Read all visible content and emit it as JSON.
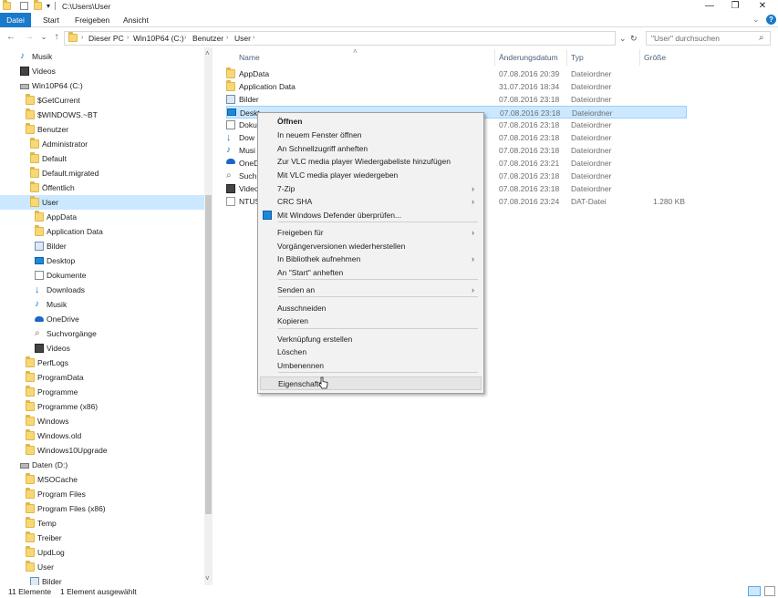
{
  "window": {
    "path": "C:\\Users\\User",
    "min_icon": "minimize-icon",
    "max_icon": "restore-icon",
    "close_icon": "close-icon",
    "min_glyph": "—",
    "max_glyph": "❐",
    "close_glyph": "✕"
  },
  "ribbon": {
    "tabs": [
      "Datei",
      "Start",
      "Freigeben",
      "Ansicht"
    ],
    "accent": "#1979ca",
    "help_glyph": "?",
    "expand_glyph": "⌄"
  },
  "address": {
    "back": "←",
    "forward": "→",
    "recent": "⌄",
    "up": "↑",
    "crumbs": [
      "Dieser PC",
      "Win10P64 (C:)",
      "Benutzer",
      "User"
    ],
    "sep": "›",
    "dropdown": "⌄",
    "refresh": "↻"
  },
  "search": {
    "placeholder": "\"User\" durchsuchen",
    "icon": "⌕"
  },
  "nav": {
    "items": [
      {
        "label": "Musik",
        "icon": "music-icon"
      },
      {
        "label": "Videos",
        "icon": "videos-icon"
      },
      {
        "label": "Win10P64 (C:)",
        "icon": "drive-icon"
      },
      {
        "label": "$GetCurrent",
        "icon": "folder-icon"
      },
      {
        "label": "$WINDOWS.~BT",
        "icon": "folder-icon"
      },
      {
        "label": "Benutzer",
        "icon": "folder-icon"
      },
      {
        "label": "Administrator",
        "icon": "folder-icon"
      },
      {
        "label": "Default",
        "icon": "folder-icon"
      },
      {
        "label": "Default.migrated",
        "icon": "folder-icon"
      },
      {
        "label": "Öffentlich",
        "icon": "folder-icon"
      },
      {
        "label": "User",
        "icon": "folder-icon"
      },
      {
        "label": "AppData",
        "icon": "folder-icon"
      },
      {
        "label": "Application Data",
        "icon": "folder-icon"
      },
      {
        "label": "Bilder",
        "icon": "pictures-icon"
      },
      {
        "label": "Desktop",
        "icon": "desktop-icon"
      },
      {
        "label": "Dokumente",
        "icon": "documents-icon"
      },
      {
        "label": "Downloads",
        "icon": "downloads-icon"
      },
      {
        "label": "Musik",
        "icon": "music-icon"
      },
      {
        "label": "OneDrive",
        "icon": "onedrive-icon"
      },
      {
        "label": "Suchvorgänge",
        "icon": "search-icon"
      },
      {
        "label": "Videos",
        "icon": "videos-icon"
      },
      {
        "label": "PerfLogs",
        "icon": "folder-icon"
      },
      {
        "label": "ProgramData",
        "icon": "folder-icon"
      },
      {
        "label": "Programme",
        "icon": "folder-icon"
      },
      {
        "label": "Programme (x86)",
        "icon": "folder-icon"
      },
      {
        "label": "Windows",
        "icon": "folder-icon"
      },
      {
        "label": "Windows.old",
        "icon": "folder-icon"
      },
      {
        "label": "Windows10Upgrade",
        "icon": "folder-icon"
      },
      {
        "label": "Daten (D:)",
        "icon": "drive-icon"
      },
      {
        "label": "MSOCache",
        "icon": "folder-icon"
      },
      {
        "label": "Program Files",
        "icon": "folder-icon"
      },
      {
        "label": "Program Files (x86)",
        "icon": "folder-icon"
      },
      {
        "label": "Temp",
        "icon": "folder-icon"
      },
      {
        "label": "Treiber",
        "icon": "folder-icon"
      },
      {
        "label": "UpdLog",
        "icon": "folder-icon"
      },
      {
        "label": "User",
        "icon": "folder-icon"
      },
      {
        "label": "Bilder",
        "icon": "pictures-icon"
      }
    ],
    "scroll_up": "˄",
    "scroll_down": "˅"
  },
  "columns": {
    "name": "Name",
    "date": "Änderungsdatum",
    "type": "Typ",
    "size": "Größe",
    "sort_glyph": "˄"
  },
  "files": [
    {
      "name": "AppData",
      "date": "07.08.2016 20:39",
      "type": "Dateiordner",
      "size": "",
      "icon": "folder-icon"
    },
    {
      "name": "Application Data",
      "date": "31.07.2016 18:34",
      "type": "Dateiordner",
      "size": "",
      "icon": "folder-icon"
    },
    {
      "name": "Bilder",
      "date": "07.08.2016 23:18",
      "type": "Dateiordner",
      "size": "",
      "icon": "pictures-icon"
    },
    {
      "name": "Desktop",
      "date": "07.08.2016 23:18",
      "type": "Dateiordner",
      "size": "",
      "icon": "desktop-icon"
    },
    {
      "name": "Dokumente",
      "date": "07.08.2016 23:18",
      "type": "Dateiordner",
      "size": "",
      "icon": "documents-icon"
    },
    {
      "name": "Downloads",
      "date": "07.08.2016 23:18",
      "type": "Dateiordner",
      "size": "",
      "icon": "downloads-icon"
    },
    {
      "name": "Musik",
      "date": "07.08.2016 23:18",
      "type": "Dateiordner",
      "size": "",
      "icon": "music-icon"
    },
    {
      "name": "OneDrive",
      "date": "07.08.2016 23:21",
      "type": "Dateiordner",
      "size": "",
      "icon": "onedrive-icon"
    },
    {
      "name": "Suchvorgänge",
      "date": "07.08.2016 23:18",
      "type": "Dateiordner",
      "size": "",
      "icon": "search-icon"
    },
    {
      "name": "Videos",
      "date": "07.08.2016 23:18",
      "type": "Dateiordner",
      "size": "",
      "icon": "videos-icon"
    },
    {
      "name": "NTUSER.DAT",
      "date": "07.08.2016 23:24",
      "type": "DAT-Datei",
      "size": "1.280 KB",
      "icon": "file-icon"
    }
  ],
  "file_name_visible": [
    "AppData",
    "Application Data",
    "Bilder",
    "Deskt",
    "Doku",
    "Dow",
    "Musi",
    "OneD",
    "Such",
    "Video",
    "NTUS"
  ],
  "context_menu": {
    "items": [
      {
        "label": "Öffnen",
        "bold": true
      },
      {
        "label": "In neuem Fenster öffnen"
      },
      {
        "label": "An Schnellzugriff anheften"
      },
      {
        "label": "Zur VLC media player Wiedergabeliste hinzufügen"
      },
      {
        "label": "Mit VLC media player wiedergeben"
      },
      {
        "label": "7-Zip",
        "submenu": true
      },
      {
        "label": "CRC SHA",
        "submenu": true
      },
      {
        "label": "Mit Windows Defender überprüfen...",
        "icon": "windows-defender-icon"
      },
      {
        "label": "Freigeben für",
        "submenu": true
      },
      {
        "label": "Vorgängerversionen wiederherstellen"
      },
      {
        "label": "In Bibliothek aufnehmen",
        "submenu": true
      },
      {
        "label": "An \"Start\" anheften"
      },
      {
        "label": "Senden an",
        "submenu": true
      },
      {
        "label": "Ausschneiden"
      },
      {
        "label": "Kopieren"
      },
      {
        "label": "Verknüpfung erstellen"
      },
      {
        "label": "Löschen"
      },
      {
        "label": "Umbenennen"
      },
      {
        "label": "Eigenschaften",
        "hover": true
      }
    ],
    "submenu_glyph": "›"
  },
  "status": {
    "count": "11 Elemente",
    "selected": "1 Element ausgewählt"
  },
  "colors": {
    "selection": "#cce8ff",
    "folder": "#f8d775",
    "accent": "#1979ca",
    "header_text": "#4c607a"
  }
}
